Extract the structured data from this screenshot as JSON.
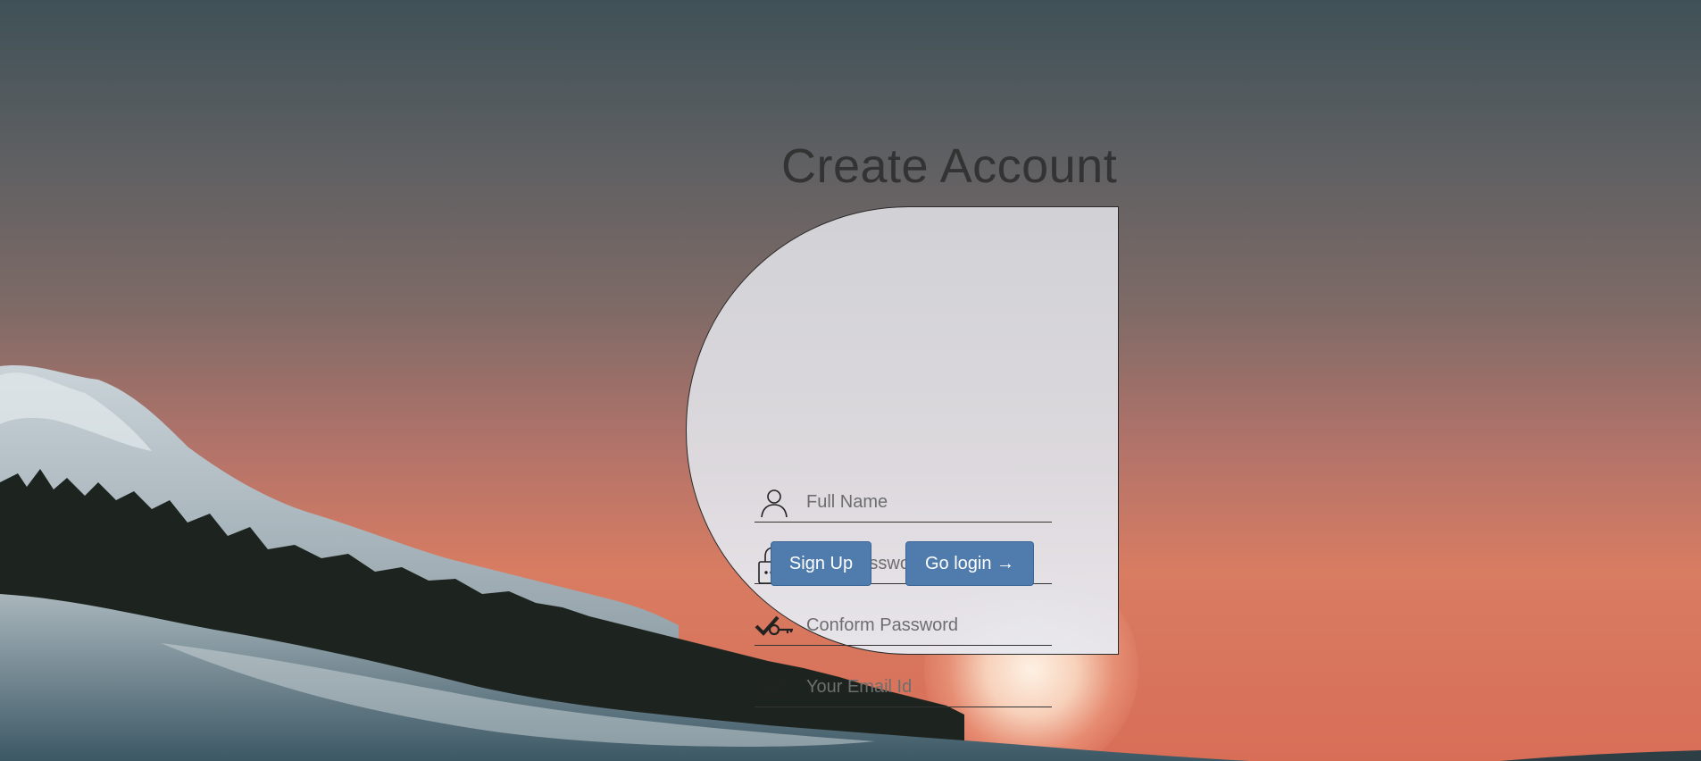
{
  "page": {
    "title": "Create Account"
  },
  "form": {
    "fields": [
      {
        "name": "full-name",
        "icon": "user-icon",
        "placeholder": "Full Name",
        "value": ""
      },
      {
        "name": "password",
        "icon": "lock-icon",
        "placeholder": "Your Password",
        "value": ""
      },
      {
        "name": "confirm-password",
        "icon": "check-key-icon",
        "placeholder": "Conform Password",
        "value": ""
      },
      {
        "name": "email",
        "icon": "envelope-icon",
        "placeholder": "Your Email Id",
        "value": ""
      }
    ],
    "buttons": {
      "signup_label": "Sign Up",
      "login_label": "Go login →"
    }
  },
  "colors": {
    "button": "#4f7cad",
    "title": "#333333",
    "card": "#d8d8dc"
  }
}
